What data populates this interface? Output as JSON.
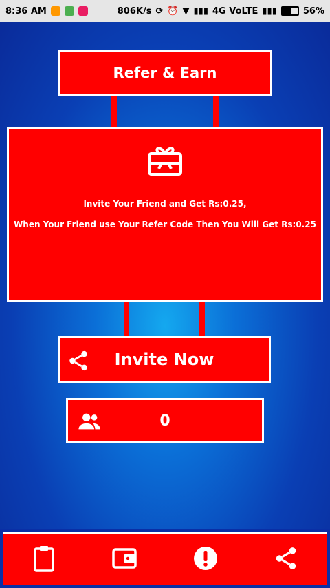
{
  "status_bar": {
    "time": "8:36 AM",
    "speed": "806K/s",
    "network": "4G VoLTE",
    "battery": "56%"
  },
  "header": {
    "title": "Refer & Earn"
  },
  "card": {
    "line1": "Invite Your Friend and Get Rs:0.25,",
    "line2": "When Your Friend use Your Refer Code Then You Will Get Rs:0.25"
  },
  "invite": {
    "label": "Invite Now"
  },
  "referrals": {
    "count": "0"
  },
  "icons": {
    "card": "gift-card-icon",
    "invite": "share-icon",
    "referrals": "group-icon",
    "nav": [
      "clipboard-icon",
      "wallet-icon",
      "alert-icon",
      "share-icon"
    ]
  },
  "colors": {
    "accent_red": "#ff0000",
    "background_blue": "#0a3fb4",
    "white": "#ffffff"
  }
}
